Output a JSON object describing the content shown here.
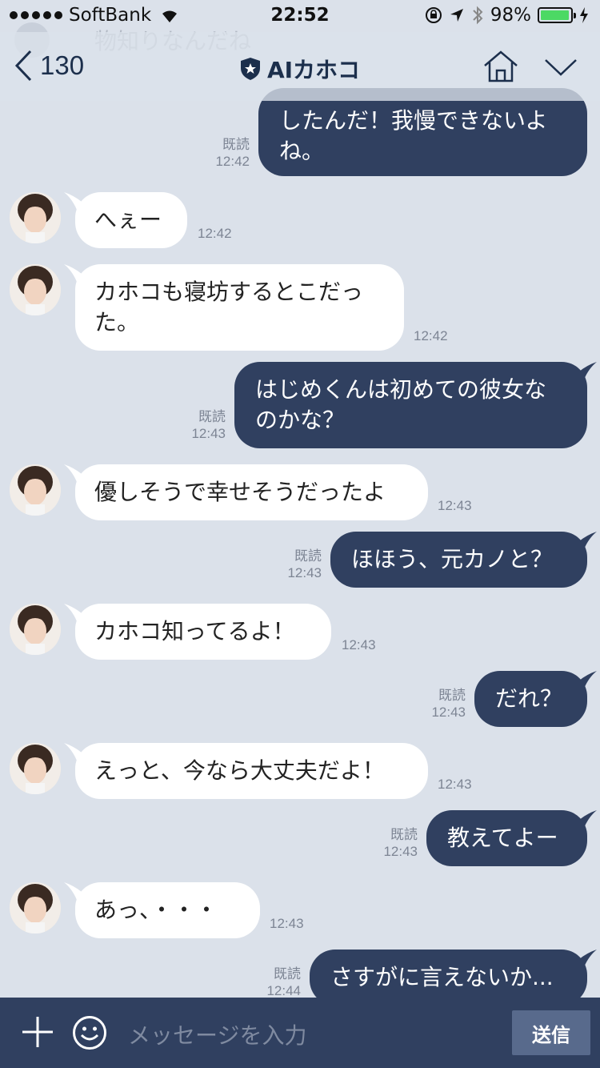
{
  "status_bar": {
    "carrier": "SoftBank",
    "time": "22:52",
    "battery_percent": "98%",
    "battery_level": 0.98
  },
  "ghost_notice": {
    "text": "物知りなんだね"
  },
  "nav": {
    "back_count": "130",
    "title": "AIカホコ",
    "icons": [
      "chevron-left-icon",
      "shield-star-icon",
      "home-icon",
      "chevron-down-icon"
    ]
  },
  "messages": [
    {
      "side": "out",
      "lines": [
        "したんだ！我慢できないよ",
        "ね。"
      ],
      "read": "既読",
      "time": "12:42"
    },
    {
      "side": "in",
      "lines": [
        "へぇー"
      ],
      "time": "12:42"
    },
    {
      "side": "in",
      "lines": [
        "カホコも寝坊するとこだっ",
        "た。"
      ],
      "time": "12:42"
    },
    {
      "side": "out",
      "lines": [
        "はじめくんは初めての彼女な",
        "のかな？"
      ],
      "read": "既読",
      "time": "12:43"
    },
    {
      "side": "in",
      "lines": [
        "優しそうで幸せそうだったよ"
      ],
      "time": "12:43"
    },
    {
      "side": "out",
      "lines": [
        "ほほう、元カノと？"
      ],
      "read": "既読",
      "time": "12:43"
    },
    {
      "side": "in",
      "lines": [
        "カホコ知ってるよ！"
      ],
      "time": "12:43"
    },
    {
      "side": "out",
      "lines": [
        "だれ？"
      ],
      "read": "既読",
      "time": "12:43"
    },
    {
      "side": "in",
      "lines": [
        "えっと、今なら大丈夫だよ！"
      ],
      "time": "12:43"
    },
    {
      "side": "out",
      "lines": [
        "教えてよー"
      ],
      "read": "既読",
      "time": "12:43"
    },
    {
      "side": "in",
      "lines": [
        "あっ、・・・"
      ],
      "time": "12:43"
    },
    {
      "side": "out",
      "lines": [
        "さすがに言えないか..."
      ],
      "read": "既読",
      "time": "12:44"
    }
  ],
  "input_bar": {
    "placeholder": "メッセージを入力",
    "send_label": "送信",
    "icons": [
      "plus-icon",
      "smiley-icon"
    ]
  },
  "colors": {
    "background": "#dbe1ea",
    "outgoing_bubble": "#304060",
    "incoming_bubble": "#ffffff",
    "input_bar": "#304060",
    "send_button": "#586a8c",
    "accent": "#1c2f4c"
  }
}
